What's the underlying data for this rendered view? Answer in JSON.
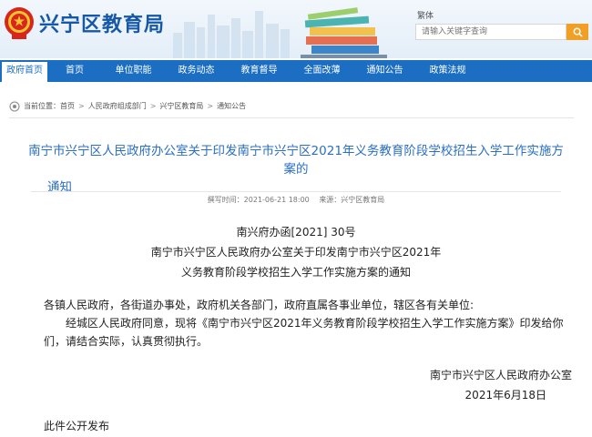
{
  "header": {
    "site_title": "兴宁区教育局",
    "traditional_link": "繁体",
    "search_placeholder": "请输入关键字查询"
  },
  "nav": [
    {
      "label": "政府首页",
      "active": true
    },
    {
      "label": "首页"
    },
    {
      "label": "单位职能"
    },
    {
      "label": "政务动态"
    },
    {
      "label": "教育督导"
    },
    {
      "label": "全面改薄"
    },
    {
      "label": "通知公告"
    },
    {
      "label": "政策法规"
    }
  ],
  "breadcrumb": {
    "prefix": "当前位置：",
    "items": [
      "首页",
      "人民政府组成部门",
      "兴宁区教育局",
      "通知公告"
    ],
    "separator": ">"
  },
  "article": {
    "title_line1": "南宁市兴宁区人民政府办公室关于印发南宁市兴宁区2021年义务教育阶段学校招生入学工作实施方案的",
    "title_line2": "通知",
    "meta_date": "撰写时间：2021-06-21 18:00",
    "meta_source": "来源：兴宁区教育局",
    "doc_number": "南兴府办函[2021] 30号",
    "doc_heading_line1": "南宁市兴宁区人民政府办公室关于印发南宁市兴宁区2021年",
    "doc_heading_line2": "义务教育阶段学校招生入学工作实施方案的通知",
    "recipients": "各镇人民政府，各街道办事处，政府机关各部门，政府直属各事业单位，辖区各有关单位:",
    "body_line1": "经城区人民政府同意，现将《南宁市兴宁区2021年义务教育阶段学校招生入学工作实施方案》印发给你",
    "body_line2": "们，请结合实际，认真贯彻执行。",
    "signature": "南宁市兴宁区人民政府办公室",
    "date": "2021年6月18日",
    "publish_note": "此件公开发布"
  },
  "colors": {
    "brand_blue": "#1b6ec2",
    "title_blue": "#2a6fc4",
    "search_button": "#f0a024"
  },
  "icons": {
    "emblem": "national-emblem-icon",
    "search": "search-icon",
    "breadcrumb": "location-icon"
  }
}
